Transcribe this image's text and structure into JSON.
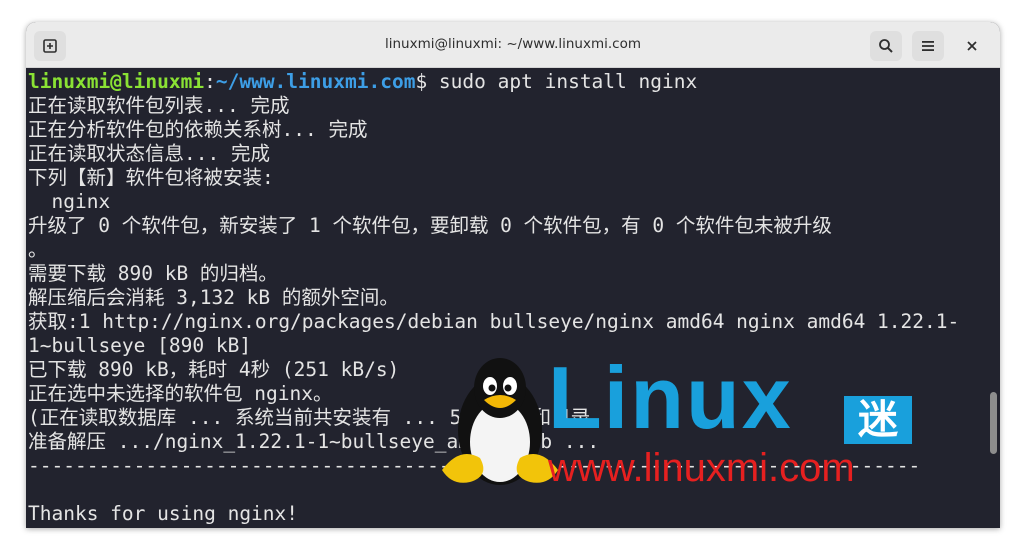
{
  "window": {
    "title": "linuxmi@linuxmi: ~/www.linuxmi.com"
  },
  "toolbar": {
    "new_tab_icon": "new-tab-icon",
    "search_icon": "search-icon",
    "menu_icon": "hamburger-menu-icon",
    "close_icon": "close-icon"
  },
  "terminal": {
    "prompt_user": "linuxmi@linuxmi",
    "prompt_colon": ":",
    "prompt_path": "~/www.linuxmi.com",
    "prompt_command": "$ sudo apt install nginx",
    "lines": [
      "正在读取软件包列表... 完成",
      "正在分析软件包的依赖关系树... 完成",
      "正在读取状态信息... 完成",
      "下列【新】软件包将被安装:",
      "  nginx",
      "升级了 0 个软件包，新安装了 1 个软件包，要卸载 0 个软件包，有 0 个软件包未被升级",
      "。",
      "需要下载 890 kB 的归档。",
      "解压缩后会消耗 3,132 kB 的额外空间。",
      "获取:1 http://nginx.org/packages/debian bullseye/nginx amd64 nginx amd64 1.22.1-",
      "1~bullseye [890 kB]",
      "已下载 890 kB，耗时 4秒 (251 kB/s)",
      "正在选中未选择的软件包 nginx。",
      "(正在读取数据库 ... 系统当前共安装有 ... 5 个文件和目录",
      "准备解压 .../nginx_1.22.1-1~bullseye_amd64.deb ...",
      "----------------------------------------------------------------------------",
      "",
      "Thanks for using nginx!"
    ]
  },
  "watermark": {
    "brand": "Linux",
    "brand_suffix": "迷",
    "url": "www.linuxmi.com",
    "colors": {
      "brand": "#19a0dc",
      "url": "#e62020"
    }
  }
}
